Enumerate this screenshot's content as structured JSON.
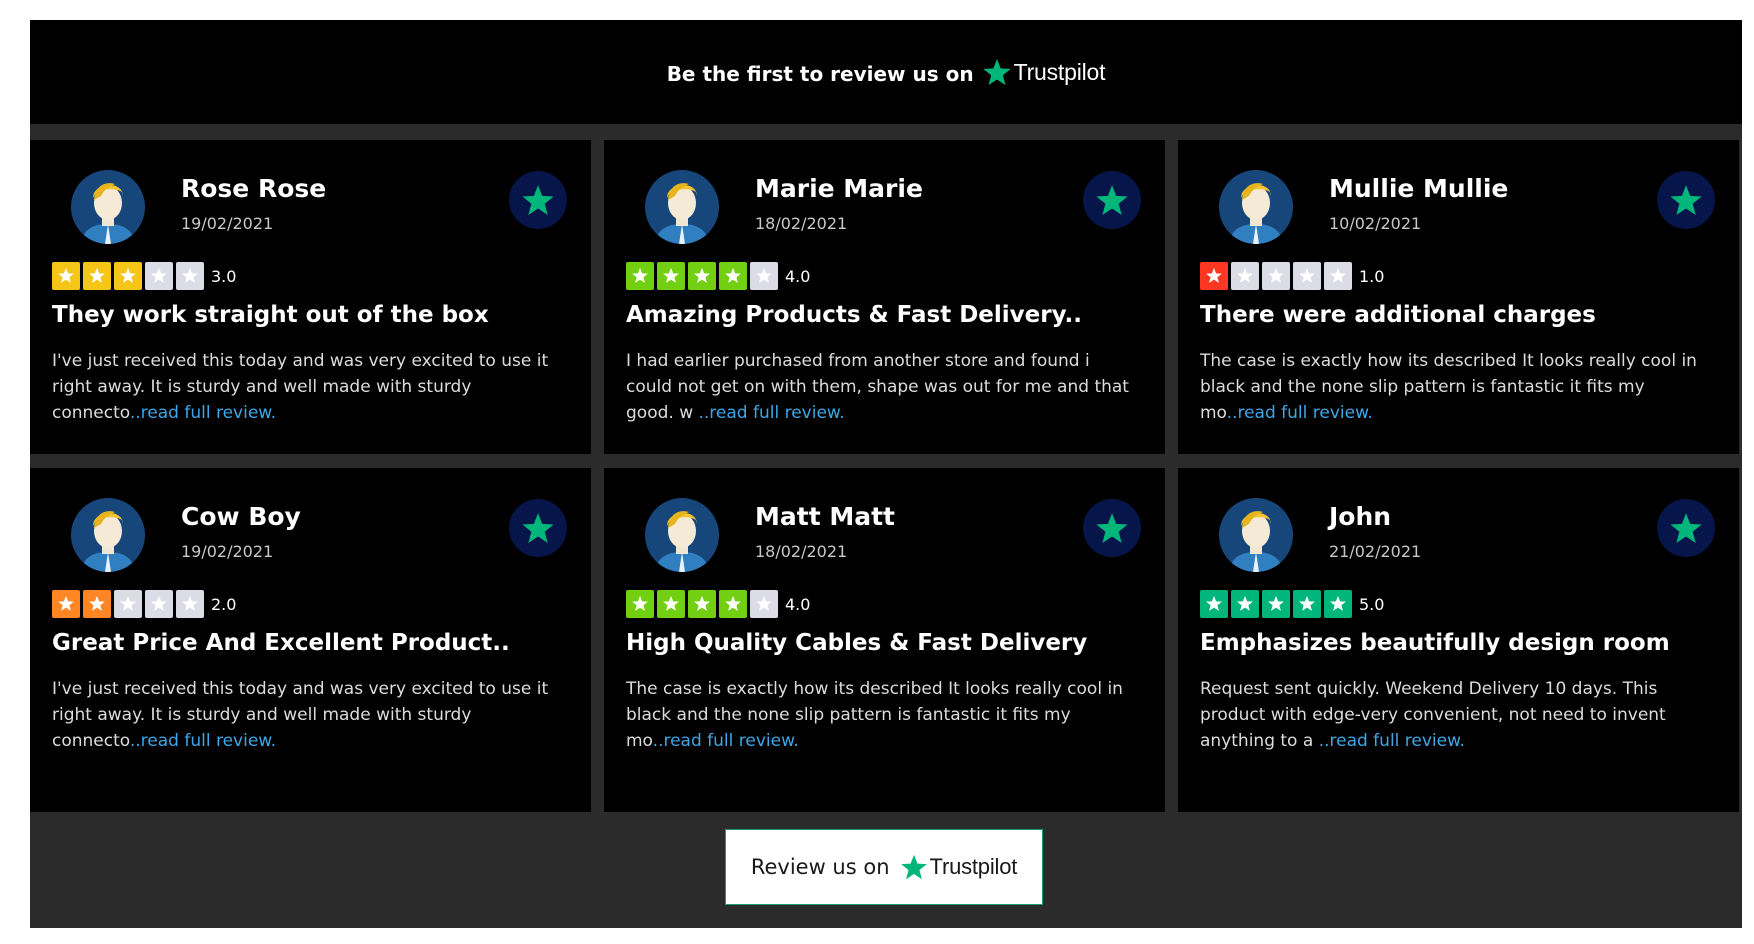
{
  "header": {
    "prefix": "Be the first to review us on",
    "brand": "Trustpilot"
  },
  "colors": {
    "brand_green": "#00b67a",
    "star_yellow": "#f5c518",
    "star_light_green": "#73cf11",
    "star_orange": "#ff8622",
    "star_red": "#ff3722",
    "star_empty": "#dcdce6",
    "badge_navy": "#07164a",
    "link_blue": "#3ea6e6"
  },
  "reviews": [
    {
      "name": "Rose Rose",
      "date": "19/02/2021",
      "rating": 3,
      "rating_text": "3.0",
      "title": "They work straight out of the box",
      "body": "I've just received this today and was very excited to use it\nright away. It is sturdy and well made with sturdy connecto",
      "read_more": "..read full review."
    },
    {
      "name": "Marie Marie",
      "date": "18/02/2021",
      "rating": 4,
      "rating_text": "4.0",
      "title": "Amazing Products & Fast Delivery..",
      "body": "I had earlier purchased from another store and found i\ncould not get on with them, shape was out for me and that\ngood. w ",
      "read_more": "..read full review."
    },
    {
      "name": "Mullie Mullie",
      "date": "10/02/2021",
      "rating": 1,
      "rating_text": "1.0",
      "title": "There were additional charges",
      "body": "The case is exactly how its described It looks really cool in\nblack and the none slip pattern is fantastic it fits my mo",
      "read_more": "..read full review."
    },
    {
      "name": "Cow Boy",
      "date": "19/02/2021",
      "rating": 2,
      "rating_text": "2.0",
      "title": "Great Price And Excellent Product..",
      "body": "I've just received this today and was very excited to use it\nright away. It is sturdy and well made with sturdy connecto",
      "read_more": "..read full review."
    },
    {
      "name": "Matt Matt",
      "date": "18/02/2021",
      "rating": 4,
      "rating_text": "4.0",
      "title": "High Quality Cables & Fast Delivery",
      "body": "The case is exactly how its described It looks really cool in\nblack and the none slip pattern is fantastic it fits my mo",
      "read_more": "..read full review."
    },
    {
      "name": "John",
      "date": "21/02/2021",
      "rating": 5,
      "rating_text": "5.0",
      "title": "Emphasizes beautifully design room",
      "body": "Request sent quickly. Weekend Delivery 10 days. This\nproduct with edge-very convenient, not need to invent\nanything to a ",
      "read_more": "..read full review."
    }
  ],
  "review_button": {
    "label": "Review us on",
    "brand": "Trustpilot"
  }
}
